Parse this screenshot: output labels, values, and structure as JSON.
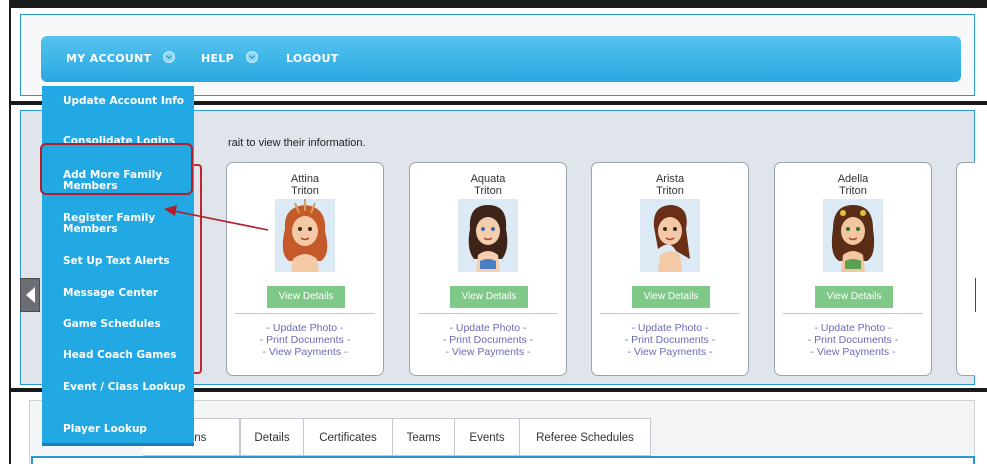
{
  "nav": {
    "my_account": "MY ACCOUNT",
    "help": "HELP",
    "logout": "LOGOUT"
  },
  "dropdown": {
    "items": [
      "Update Account Info",
      "Consolidate Logins",
      "Add More Family Members",
      "Register Family Members",
      "Set Up Text Alerts",
      "Message Center",
      "Game Schedules",
      "Head Coach Games",
      "Event / Class Lookup",
      "Player Lookup"
    ],
    "highlighted_item": "Add More Family Members"
  },
  "family": {
    "instruction": "rait to view their information.",
    "members": [
      {
        "first": "Attina",
        "last": "Triton",
        "hair": "#c45a2a",
        "skin": "#f3c9a6"
      },
      {
        "first": "Aquata",
        "last": "Triton",
        "hair": "#3e2418",
        "skin": "#f4cfae"
      },
      {
        "first": "Arista",
        "last": "Triton",
        "hair": "#6a2f16",
        "skin": "#f3c9a6"
      },
      {
        "first": "Adella",
        "last": "Triton",
        "hair": "#5a2e16",
        "skin": "#f1c6a0"
      }
    ],
    "view_details_label": "View Details",
    "update_photo_label": "- Update Photo -",
    "print_documents_label": "- Print Documents -",
    "view_payments_label": "- View Payments -"
  },
  "tabs": [
    "ations",
    "Details",
    "Certificates",
    "Teams",
    "Events",
    "Referee Schedules"
  ],
  "colors": {
    "nav_blue": "#2aa8e0",
    "dropdown_blue": "#22a8e3",
    "view_button_green": "#7ec888",
    "highlight_red": "#b01f2a",
    "link_purple": "#6b6bb5"
  },
  "icons": {
    "nav_dropdown": "chevron-down-icon",
    "carousel_left": "arrow-left-icon",
    "carousel_right": "arrow-right-icon"
  }
}
